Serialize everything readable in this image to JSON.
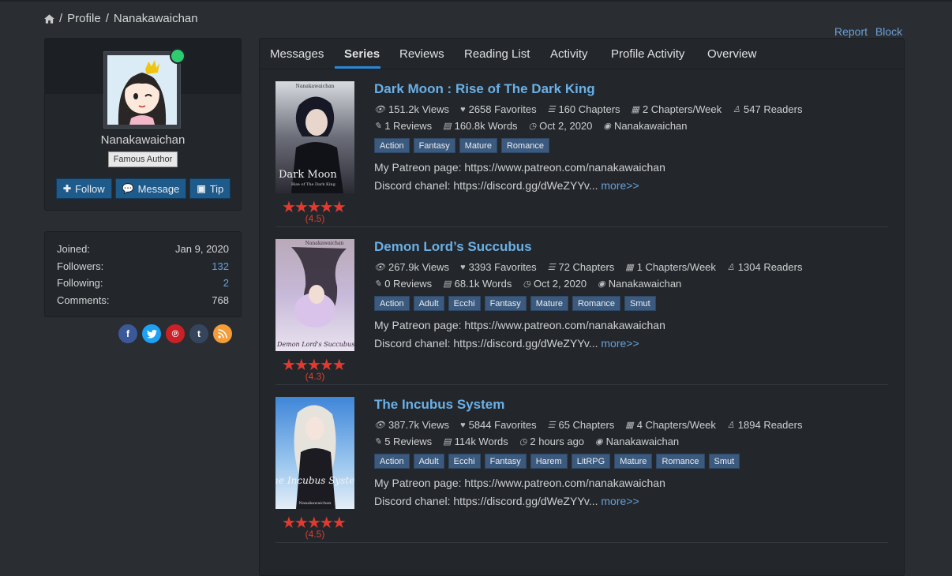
{
  "breadcrumb": {
    "sep": "/",
    "profile": "Profile",
    "user": "Nanakawaichan"
  },
  "actions": {
    "report": "Report",
    "block": "Block"
  },
  "profile": {
    "username": "Nanakawaichan",
    "badge": "Famous Author",
    "buttons": {
      "follow": "Follow",
      "message": "Message",
      "tip": "Tip"
    },
    "online_color": "#2ecc71"
  },
  "stats": [
    {
      "label": "Joined:",
      "value": "Jan 9, 2020"
    },
    {
      "label": "Followers:",
      "value": "132"
    },
    {
      "label": "Following:",
      "value": "2"
    },
    {
      "label": "Comments:",
      "value": "768"
    }
  ],
  "social_icons": [
    "facebook-icon",
    "twitter-icon",
    "pinterest-icon",
    "tumblr-icon",
    "rss-icon"
  ],
  "tabs": [
    "Messages",
    "Series",
    "Reviews",
    "Reading List",
    "Activity",
    "Profile Activity",
    "Overview"
  ],
  "active_tab": "Series",
  "series": [
    {
      "title": "Dark Moon : Rise of The Dark King",
      "views": "151.2k Views",
      "favorites": "2658 Favorites",
      "chapters": "160 Chapters",
      "per_week": "2 Chapters/Week",
      "readers": "547 Readers",
      "reviews": "1 Reviews",
      "words": "160.8k Words",
      "updated": "Oct 2, 2020",
      "author": "Nanakawaichan",
      "tags": [
        "Action",
        "Fantasy",
        "Mature",
        "Romance"
      ],
      "desc1": "My Patreon page: https://www.patreon.com/nanakawaichan",
      "desc2": "Discord chanel: https://discord.gg/dWeZYYv...",
      "more": "more>>",
      "stars": "★★★★★",
      "rating": "(4.5)",
      "rating_value": 4.5
    },
    {
      "title": "Demon Lord’s Succubus",
      "views": "267.9k Views",
      "favorites": "3393 Favorites",
      "chapters": "72 Chapters",
      "per_week": "1 Chapters/Week",
      "readers": "1304 Readers",
      "reviews": "0 Reviews",
      "words": "68.1k Words",
      "updated": "Oct 2, 2020",
      "author": "Nanakawaichan",
      "tags": [
        "Action",
        "Adult",
        "Ecchi",
        "Fantasy",
        "Mature",
        "Romance",
        "Smut"
      ],
      "desc1": "My Patreon page: https://www.patreon.com/nanakawaichan",
      "desc2": "Discord chanel: https://discord.gg/dWeZYYv...",
      "more": "more>>",
      "stars": "★★★★★",
      "rating": "(4.3)",
      "rating_value": 4.3
    },
    {
      "title": "The Incubus System",
      "views": "387.7k Views",
      "favorites": "5844 Favorites",
      "chapters": "65 Chapters",
      "per_week": "4 Chapters/Week",
      "readers": "1894 Readers",
      "reviews": "5 Reviews",
      "words": "114k Words",
      "updated": "2 hours ago",
      "author": "Nanakawaichan",
      "tags": [
        "Action",
        "Adult",
        "Ecchi",
        "Fantasy",
        "Harem",
        "LitRPG",
        "Mature",
        "Romance",
        "Smut"
      ],
      "desc1": "My Patreon page: https://www.patreon.com/nanakawaichan",
      "desc2": "Discord chanel: https://discord.gg/dWeZYYv...",
      "more": "more>>",
      "stars": "★★★★★",
      "rating": "(4.5)",
      "rating_value": 4.5
    }
  ],
  "cover_texts": [
    {
      "top": "Nanakawaichan",
      "title": "Dark Moon",
      "sub": "Rise of The Dark King"
    },
    {
      "top": "Nanakawaichan",
      "title": "Demon Lord's Succubus",
      "sub": ""
    },
    {
      "top": "",
      "title": "The Incubus System",
      "sub": "Nanakawaichan"
    }
  ]
}
